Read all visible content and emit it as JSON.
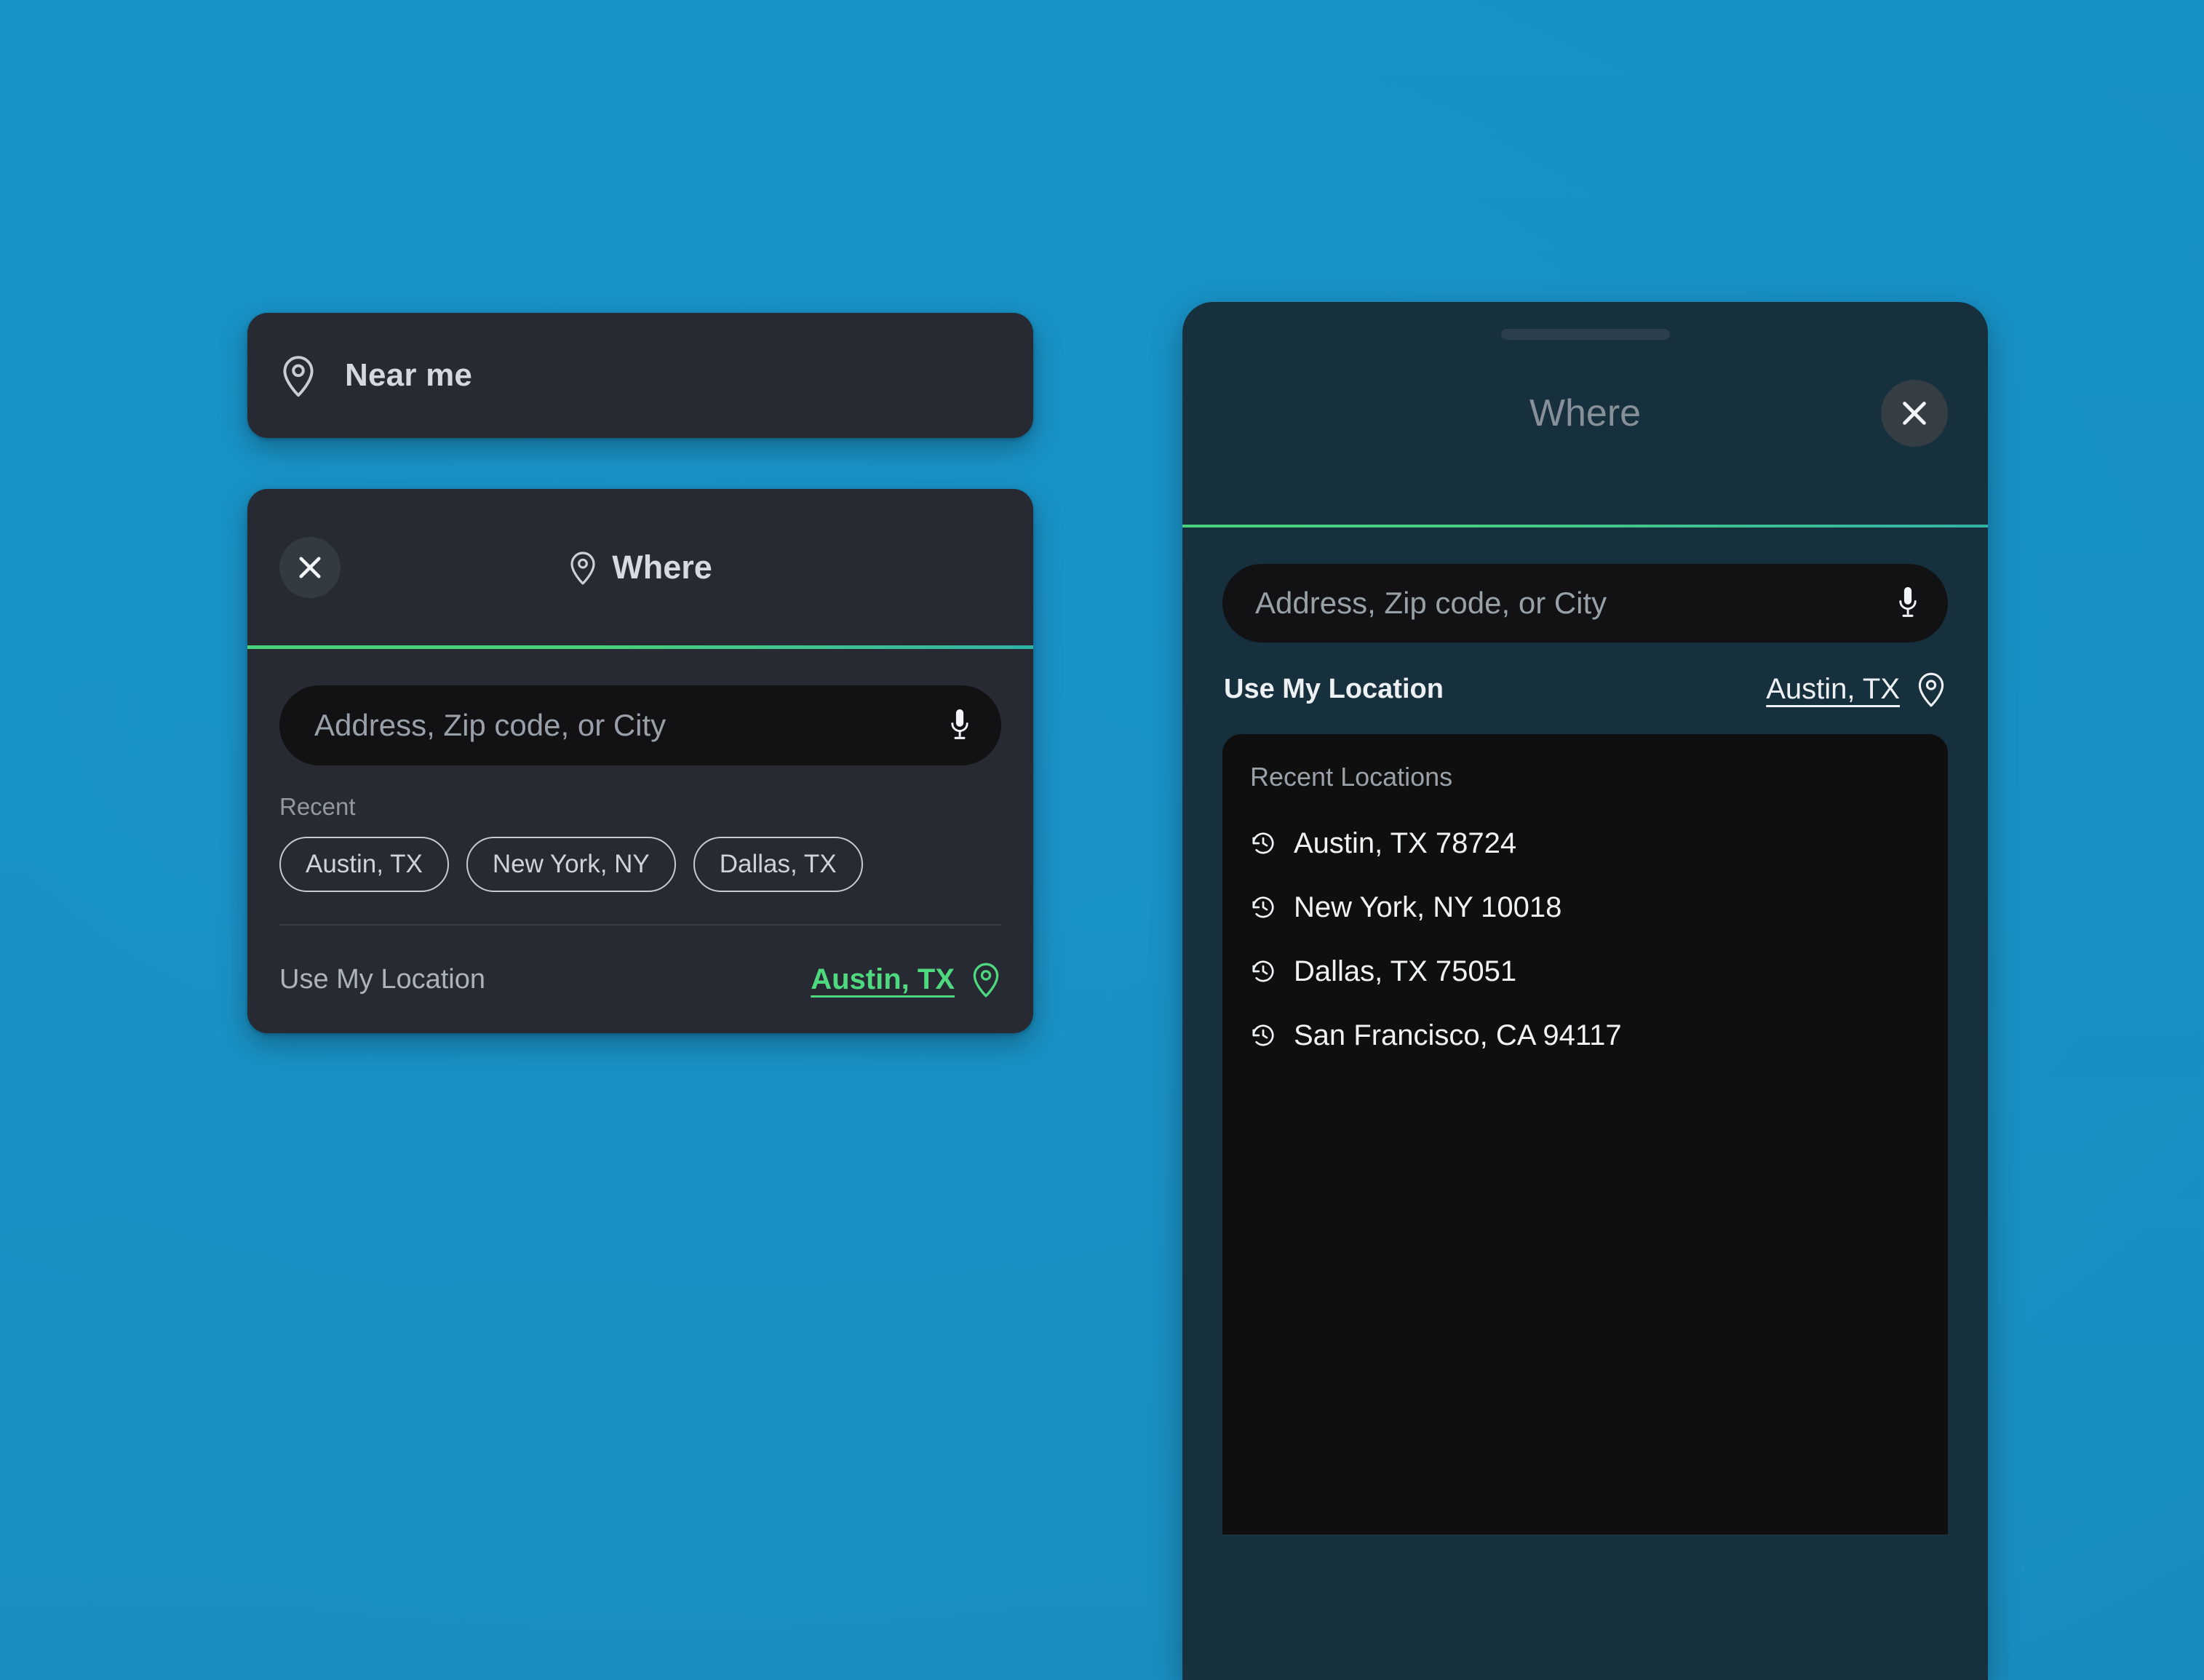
{
  "background": {
    "color": "#1a95ca"
  },
  "accent": {
    "green": "#4ad17b",
    "teal": "#30b3a6"
  },
  "near_me_card": {
    "icon": "map-pin-icon",
    "label": "Near me"
  },
  "where_card": {
    "close_label": "×",
    "title": "Where",
    "title_icon": "map-pin-icon",
    "search": {
      "value": "",
      "placeholder": "Address, Zip code, or City",
      "mic_icon": "microphone-icon"
    },
    "recent_label": "Recent",
    "recent_chips": [
      "Austin, TX",
      "New York, NY",
      "Dallas, TX"
    ],
    "use_my_location": {
      "label": "Use My Location",
      "city": "Austin, TX",
      "icon": "map-pin-icon"
    }
  },
  "phone_panel": {
    "drag_handle": "sheet-drag-handle",
    "title": "Where",
    "close_label": "×",
    "search": {
      "value": "",
      "placeholder": "Address, Zip code, or City",
      "mic_icon": "microphone-icon"
    },
    "use_my_location": {
      "label": "Use My Location",
      "city": "Austin, TX",
      "icon": "map-pin-icon"
    },
    "recents": {
      "title": "Recent Locations",
      "items": [
        {
          "label": "Austin, TX 78724",
          "icon": "history-icon"
        },
        {
          "label": "New York, NY 10018",
          "icon": "history-icon"
        },
        {
          "label": "Dallas, TX 75051",
          "icon": "history-icon"
        },
        {
          "label": "San Francisco, CA 94117",
          "icon": "history-icon"
        }
      ]
    }
  }
}
